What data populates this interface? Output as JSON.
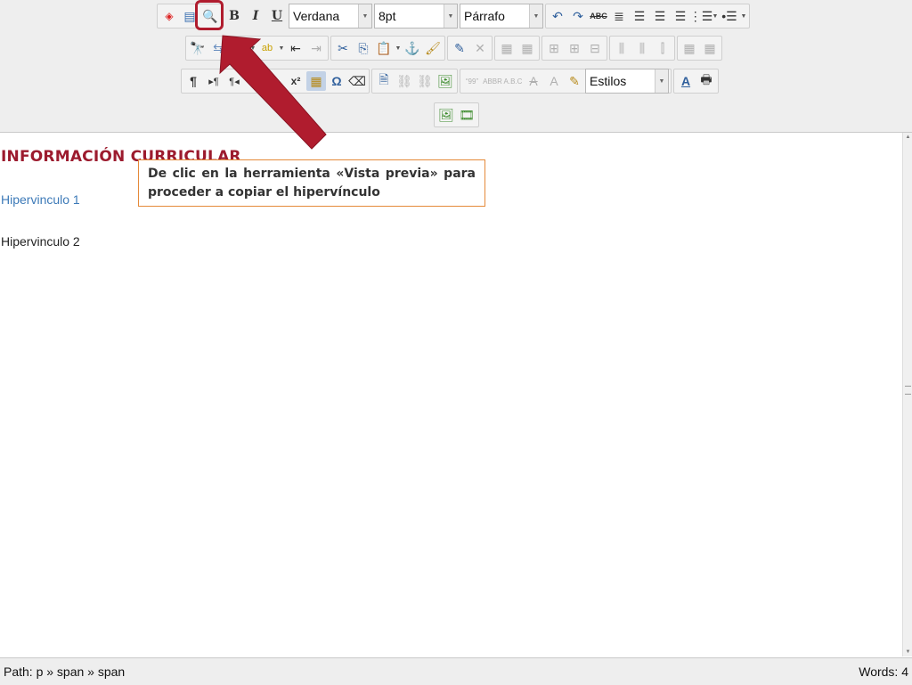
{
  "toolbar": {
    "font_family": "Verdana",
    "font_size": "8pt",
    "block_format": "Párrafo",
    "styles": "Estilos",
    "bold_label": "B",
    "italic_label": "I",
    "underline_label": "U",
    "spellcheck_label": "ABC",
    "paragraph_mark": "¶",
    "omega_label": "Ω",
    "subscript_label": "x₂",
    "superscript_label": "x²"
  },
  "content": {
    "heading": "INFORMACIÓN CURRICULAR",
    "link1": "Hipervinculo 1",
    "text2": "Hipervinculo 2"
  },
  "callout": {
    "text": "De clic en la herramienta «Vista previa» para proceder a copiar el hipervínculo"
  },
  "statusbar": {
    "path": "Path: p » span » span",
    "words": "Words: 4"
  },
  "colors": {
    "heading": "#9c1b2e",
    "link": "#3d7ab8",
    "highlight": "#b01c2e",
    "callout_border": "#e58a3a"
  }
}
